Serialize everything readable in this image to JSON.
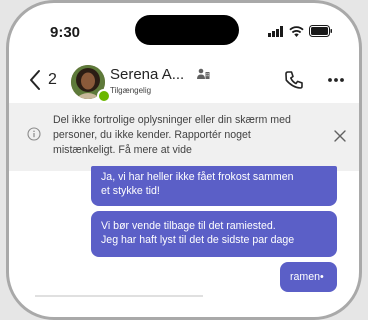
{
  "status_bar": {
    "time": "9:30"
  },
  "header": {
    "back_count": "2",
    "contact_name": "Serena A...",
    "contact_status": "Tilgængelig"
  },
  "banner": {
    "text": "Del ikke fortrolige oplysninger eller din skærm med personer, du ikke kender. Rapportér noget mistænkeligt. Få mere at vide"
  },
  "messages": [
    {
      "line1": "Ja, vi har heller ikke fået frokost sammen",
      "line2": "et stykke tid!"
    },
    {
      "line1": "Vi bør vende tilbage til det ramiested.",
      "line2": "Jeg har haft lyst til det de sidste par dage"
    },
    {
      "text": "ramen•"
    }
  ],
  "colors": {
    "bubble": "#5b5fc7",
    "banner_bg": "#f0f0f0",
    "presence": "#6bb700"
  }
}
